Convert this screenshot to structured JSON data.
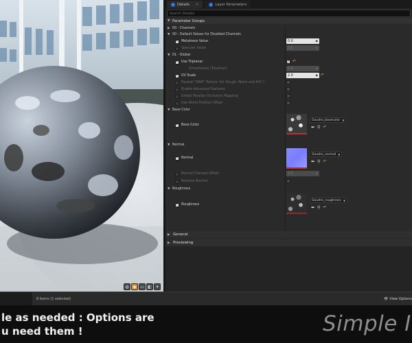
{
  "tabs": [
    {
      "label": "Details",
      "active": true
    },
    {
      "label": "Layer Parameters",
      "active": false
    }
  ],
  "search": {
    "placeholder": "Search Details"
  },
  "parameter_groups_label": "Parameter Groups",
  "groups": {
    "channels": "00 - Channels",
    "defaults": "00 - Default Values for Disabled Channels",
    "global": "01 - Global",
    "base_color": "Base Color",
    "normal": "Normal",
    "roughness": "Roughness"
  },
  "params": {
    "metalness": {
      "label": "Metalness Value",
      "value": "0.0",
      "checked": true
    },
    "specular": {
      "label": "Specular Value",
      "value": "0.5",
      "checked": false
    },
    "use_triplanar": {
      "label": "Use Triplanar",
      "checked": true
    },
    "smoothness": {
      "label": "Smoothness (Triplanar)",
      "value": "0.4"
    },
    "uv_scale": {
      "label": "UV Scale",
      "value": "2.0",
      "checked": true
    },
    "packed_orm": {
      "label": "Packed \"ORM\" Texture (for Rough, Metal and AO) ?",
      "checked": false
    },
    "advanced": {
      "label": "Enable Advanced Features",
      "checked": false
    },
    "parallax": {
      "label": "Global Parallax Occlusion Mapping",
      "checked": false
    },
    "world_offset": {
      "label": "Use World Position Offset",
      "checked": false
    },
    "base_color_param": {
      "label": "Base Color",
      "checked": true,
      "asset": "Goudro_basecolor"
    },
    "normal_param": {
      "label": "Normal",
      "checked": true,
      "asset": "Goudro_normal"
    },
    "normal_flatness": {
      "label": "Normal Flatness Offset",
      "value": "0.0",
      "checked": false
    },
    "reverse_normal": {
      "label": "Reverse Normal",
      "checked": false
    },
    "roughness_param": {
      "label": "Roughness",
      "checked": true,
      "asset": "Goudro_roughness"
    }
  },
  "sections": {
    "general": "General",
    "previewing": "Previewing"
  },
  "statusbar": {
    "count": "8 items (1 selected)",
    "view_options": "View Options"
  },
  "caption": {
    "line1": "le as needed : Options are",
    "line2": "u need them !",
    "brand": "Simple In"
  },
  "colors": {
    "accent_orange": "#d88a2d",
    "reset_yellow": "#d9a33a",
    "texture_underline": "#b8323a",
    "tab_blue": "#2b6bd9"
  }
}
